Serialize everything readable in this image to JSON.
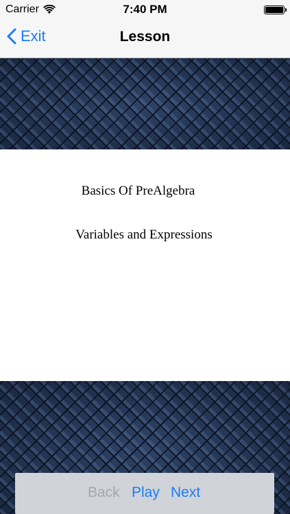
{
  "status_bar": {
    "carrier": "Carrier",
    "wifi_icon": "wifi-icon",
    "time": "7:40 PM",
    "battery_icon": "battery-icon",
    "battery_level": 1.0
  },
  "nav_bar": {
    "back_label": "Exit",
    "back_icon": "chevron-left-icon",
    "title": "Lesson"
  },
  "lesson": {
    "subject": "Basics Of PreAlgebra",
    "topic": "Variables and Expressions"
  },
  "toolbar": {
    "back_label": "Back",
    "play_label": "Play",
    "next_label": "Next",
    "back_enabled": false
  },
  "colors": {
    "accent": "#1a7cf5",
    "disabled": "#a4a8ae",
    "background_pattern": "#223350"
  }
}
